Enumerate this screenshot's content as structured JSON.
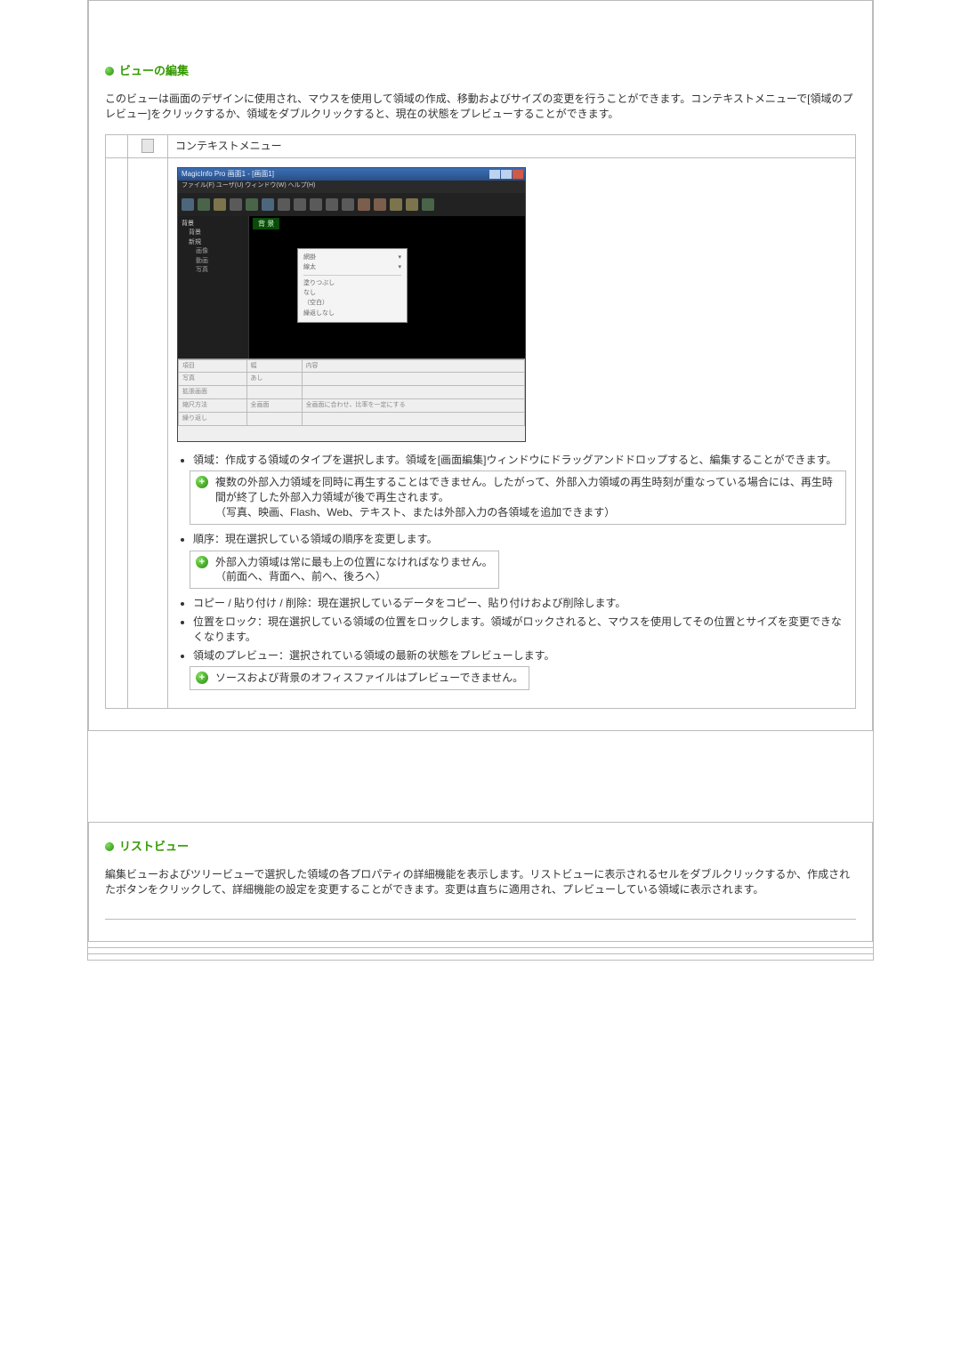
{
  "section1": {
    "heading": "ビューの編集",
    "intro": "このビューは画面のデザインに使用され、マウスを使用して領域の作成、移動およびサイズの変更を行うことができます。コンテキストメニューで[領域のプレビュー]をクリックするか、領域をダブルクリックすると、現在の状態をプレビューすることができます。",
    "context_menu_label": "コンテキストメニュー",
    "app_mock": {
      "title": "MagicInfo Pro 画面1 - [画面1]",
      "menu": "ファイル(F)  ユーザ(U)  ウィンドウ(W)  ヘルプ(H)",
      "canvas_tab": "背 景",
      "panel": {
        "r1a": "網掛",
        "r1b": "",
        "r2a": "線太",
        "r2b": "",
        "r3a": "",
        "r4a": "塗りつぶし",
        "r5a": "なし",
        "r6a": "（空白）",
        "r7a": "繰返しなし"
      },
      "tree": {
        "n1": "背景",
        "n2a": "背景",
        "n2b": "新規",
        "n3a": "画像",
        "n3b": "動画",
        "n3c": "写真"
      },
      "grid": {
        "h1": "項目",
        "h2": "幅",
        "h3": "内容",
        "r1a": "写真",
        "r1b": "あし",
        "r1c": "",
        "r2a": "拡張画面",
        "r2b": "",
        "r2c": "",
        "r3a": "縮尺方法",
        "r3b": "全画面",
        "r3c": "全画面に合わせ、比率を一定にする",
        "r4a": "繰り返し",
        "r4b": "",
        "r4c": ""
      }
    },
    "bullets": {
      "b1": "領域：作成する領域のタイプを選択します。領域を[画面編集]ウィンドウにドラッグアンドドロップすると、編集することができます。",
      "note1": "複数の外部入力領域を同時に再生することはできません。したがって、外部入力領域の再生時刻が重なっている場合には、再生時間が終了した外部入力領域が後で再生されます。\n（写真、映画、Flash、Web、テキスト、または外部入力の各領域を追加できます）",
      "b2": "順序：現在選択している領域の順序を変更します。",
      "note2": "外部入力領域は常に最も上の位置になければなりません。\n（前面へ、背面へ、前へ、後ろへ）",
      "b3": "コピー / 貼り付け / 削除：現在選択しているデータをコピー、貼り付けおよび削除します。",
      "b4": "位置をロック：現在選択している領域の位置をロックします。領域がロックされると、マウスを使用してその位置とサイズを変更できなくなります。",
      "b5": "領域のプレビュー：選択されている領域の最新の状態をプレビューします。",
      "note3": "ソースおよび背景のオフィスファイルはプレビューできません。"
    }
  },
  "section2": {
    "heading": "リストビュー",
    "intro": "編集ビューおよびツリービューで選択した領域の各プロパティの詳細機能を表示します。リストビューに表示されるセルをダブルクリックするか、作成されたボタンをクリックして、詳細機能の設定を変更することができます。変更は直ちに適用され、プレビューしている領域に表示されます。"
  }
}
